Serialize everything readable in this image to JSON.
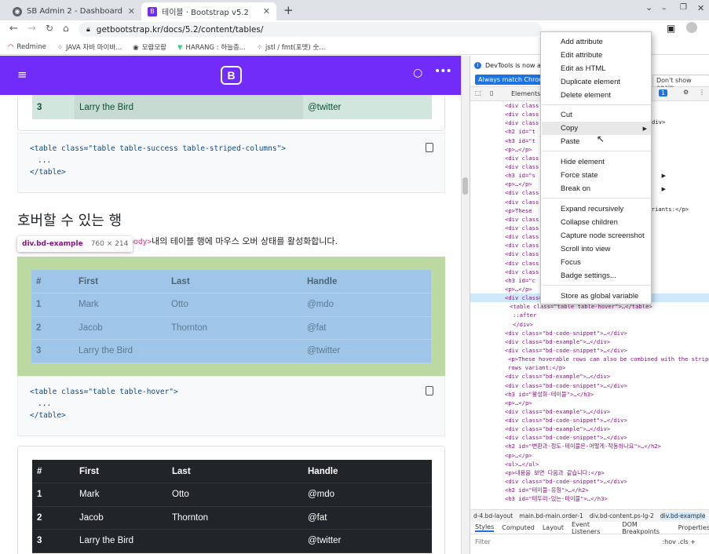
{
  "browser": {
    "tabs": [
      {
        "title": "SB Admin 2 - Dashboard"
      },
      {
        "title": "테이블 · Bootstrap v5.2"
      }
    ],
    "new_tab": "+",
    "url": "getbootstrap.kr/docs/5.2/content/tables/",
    "bookmarks": [
      "Redmine",
      "JAVA 자바 마이바...",
      "모람모람",
      "HARANG : 하늘층...",
      "jstl / fmt(포맷) 숫..."
    ]
  },
  "page": {
    "table1_last": {
      "num": "3",
      "name": "Larry the Bird",
      "handle": "@twitter"
    },
    "code1": {
      "open": "<table class=\"table table-success table-striped-columns\">",
      "dots": "...",
      "close": "</table>"
    },
    "heading": "호버할 수 있는 행",
    "tooltip": {
      "tag": "div.bd-example",
      "size": "760 × 214"
    },
    "para_code": "<tbody>",
    "para_text": "내의 테이블 행에 마우스 오버 상태를 활성화합니다.",
    "table_headers": [
      "#",
      "First",
      "Last",
      "Handle"
    ],
    "rows": [
      [
        "1",
        "Mark",
        "Otto",
        "@mdo"
      ],
      [
        "2",
        "Jacob",
        "Thornton",
        "@fat"
      ],
      [
        "3",
        "Larry the Bird",
        "",
        "@twitter"
      ]
    ],
    "code2": {
      "open": "<table class=\"table table-hover\">",
      "dots": "...",
      "close": "</table>"
    }
  },
  "devtools": {
    "info": "DevTools is now ava",
    "always_btn": "Always match Chrome'",
    "dont_btn": "Don't show again",
    "tab_elements": "Elements",
    "dom_lines": [
      "<div class",
      "<div class",
      "<div class",
      "<h2 id=\"t",
      "<h3 id=\"t",
      "<p>…</p>",
      "<div class",
      "<div class",
      "<h3 id=\"s",
      "<p>…</p>",
      "<div class",
      "<div class",
      "<p>These",
      "<div class",
      "<div class",
      "<div class",
      "<div class",
      "<div class",
      "<div class",
      "<div class",
      "<h3 id=\"c",
      "<p>…</p>",
      "<div class=\"bd-example\"> == $0",
      "<table class=\"table table-hover\">…</table>",
      "::after",
      "</div>",
      "<div class=\"bd-code-snippet\">…</div>",
      "<div class=\"bd-example\">…</div>",
      "<div class=\"bd-code-snippet\">…</div>",
      "<p>These hoverable rows can also be combined with the stripe",
      "rows variant:</p>",
      "<div class=\"bd-example\">…</div>",
      "<div class=\"bd-code-snippet\">…</div>",
      "<h3 id=\"활성화-테이블\">…</h3>",
      "<p>…</p>",
      "<div class=\"bd-example\">…</div>",
      "<div class=\"bd-code-snippet\">…</div>",
      "<div class=\"bd-example\">…</div>",
      "<div class=\"bd-code-snippet\">…</div>",
      "<h2 id=\"변환과-정도-테이블은-어떻게-작동하나요\">…</h2>",
      "<p>…</p>",
      "<ul>…</ul>",
      "<p>내용을 보면 다음과 같습니다:</p>",
      "<div class=\"bd-code-snippet\">…</div>",
      "<h2 id=\"테이블-유형\">…</h2>",
      "<h3 id=\"테두리-있는-테이블\">…</h3>"
    ],
    "dom_right": [
      "div>",
      "variants:</p>"
    ],
    "crumbs": [
      "d-4.bd-layout",
      "main.bd-main.order-1",
      "div.bd-content.ps-lg-2",
      "div.bd-example"
    ],
    "style_tabs": [
      "Styles",
      "Computed",
      "Layout",
      "Event Listeners",
      "DOM Breakpoints",
      "Properties"
    ],
    "filter": "Filter",
    "filter_right": ":hov .cls +",
    "badge": "1"
  },
  "context_menu": {
    "items": [
      "Add attribute",
      "Edit attribute",
      "Edit as HTML",
      "Duplicate element",
      "Delete element",
      "Cut",
      "Copy",
      "Paste",
      "Hide element",
      "Force state",
      "Break on",
      "Expand recursively",
      "Collapse children",
      "Capture node screenshot",
      "Scroll into view",
      "Focus",
      "Badge settings...",
      "Store as global variable"
    ]
  },
  "colors": {
    "bs_purple": "#712cf9",
    "success_row": "#d1e7dd",
    "hover_bg": "#9fc5e8",
    "example_highlight": "#bcd9a2",
    "dark_table": "#212529"
  }
}
